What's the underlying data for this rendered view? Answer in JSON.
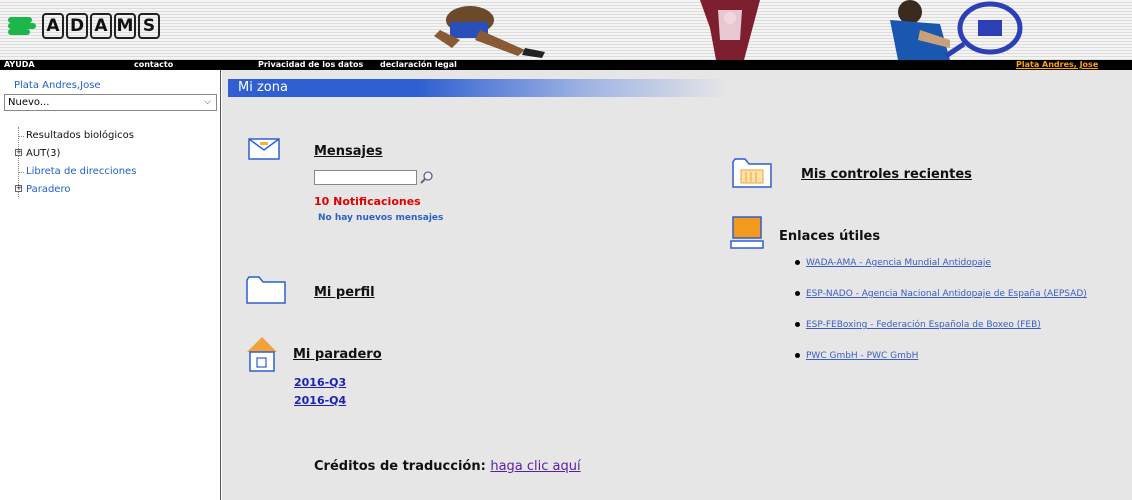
{
  "app": {
    "logo_letters": [
      "A",
      "D",
      "A",
      "M",
      "S"
    ]
  },
  "navbar": {
    "help": "AYUDA",
    "contact": "contacto",
    "privacy": "Privacidad de los datos",
    "legal": "declaración legal",
    "user": "Plata Andres, Jose"
  },
  "sidebar": {
    "user_name": "Plata Andres,Jose",
    "new_select": "Nuevo...",
    "tree": {
      "biological_results": "Resultados biológicos",
      "aut": "AUT(3)",
      "address_book": "Libreta de direcciones",
      "whereabouts": "Paradero"
    }
  },
  "main": {
    "title": "Mi zona",
    "messages": {
      "title": "Mensajes",
      "search_value": "",
      "notifications": "10 Notificaciones",
      "no_new": "No hay nuevos mensajes"
    },
    "profile": {
      "title": "Mi perfil"
    },
    "whereabouts": {
      "title": "Mi paradero",
      "quarters": [
        "2016-Q3",
        "2016-Q4"
      ]
    },
    "credits": {
      "label": "Créditos de traducción:",
      "link": "haga clic aquí"
    },
    "recent_controls": {
      "title": "Mis controles recientes"
    },
    "useful_links": {
      "title": "Enlaces útiles",
      "items": [
        "WADA-AMA - Agencia Mundial Antidopaje",
        "ESP-NADO - Agencia Nacional Antidopaje de España (AEPSAD)",
        "ESP-FEBoxing - Federación Española de Boxeo (FEB)",
        "PWC GmbH - PWC GmbH"
      ]
    }
  },
  "colors": {
    "accent_blue": "#2f5fd0",
    "logo_green": "#1db64a",
    "user_orange": "#ffa500",
    "alert_red": "#e00000"
  }
}
